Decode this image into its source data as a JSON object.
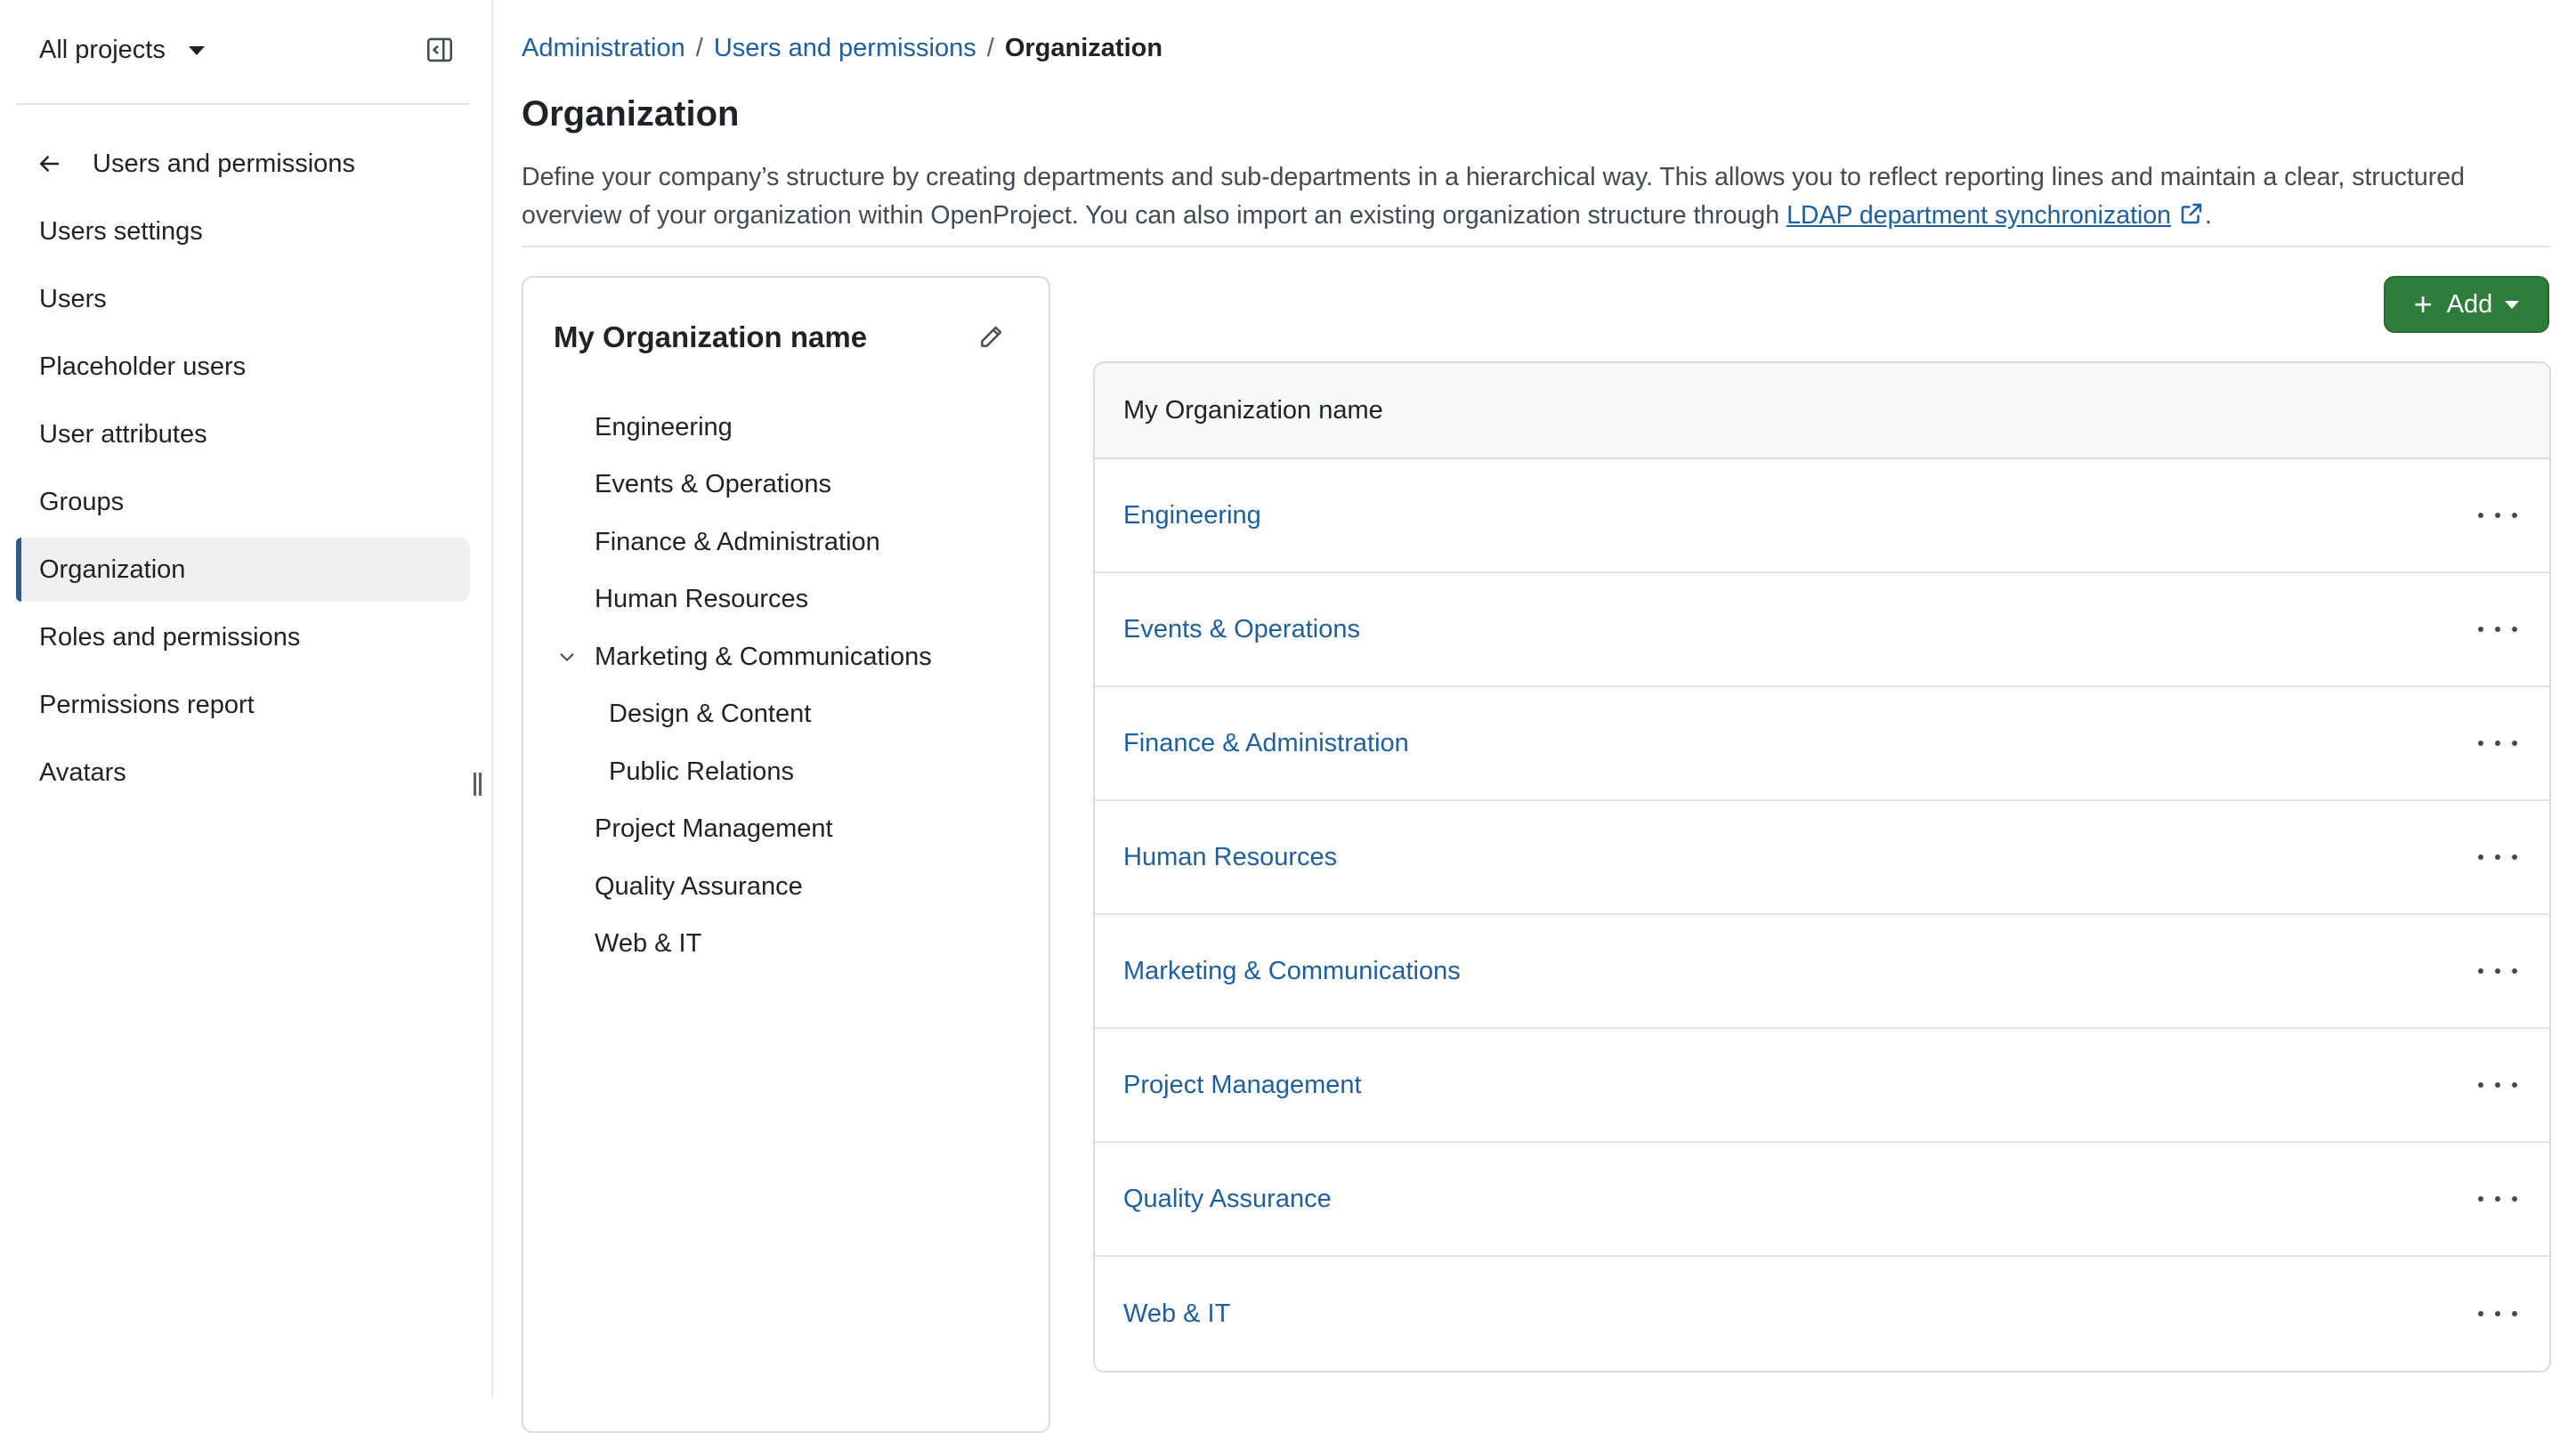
{
  "sidebar": {
    "project_switcher": "All projects",
    "back_label": "Users and permissions",
    "items": [
      {
        "label": "Users settings",
        "active": false
      },
      {
        "label": "Users",
        "active": false
      },
      {
        "label": "Placeholder users",
        "active": false
      },
      {
        "label": "User attributes",
        "active": false
      },
      {
        "label": "Groups",
        "active": false
      },
      {
        "label": "Organization",
        "active": true
      },
      {
        "label": "Roles and permissions",
        "active": false
      },
      {
        "label": "Permissions report",
        "active": false
      },
      {
        "label": "Avatars",
        "active": false
      }
    ]
  },
  "breadcrumb": {
    "items": [
      "Administration",
      "Users and permissions"
    ],
    "separator": "/",
    "current": "Organization"
  },
  "page": {
    "title": "Organization",
    "description": "Define your company’s structure by creating departments and sub-departments in a hierarchical way. This allows you to reflect reporting lines and maintain a clear, structured overview of your organization within OpenProject. You can also import an existing organization structure through",
    "link_text": "LDAP department synchronization",
    "trailing": "."
  },
  "tree": {
    "title": "My Organization name",
    "items": [
      {
        "label": "Engineering",
        "level": 0
      },
      {
        "label": "Events & Operations",
        "level": 0
      },
      {
        "label": "Finance & Administration",
        "level": 0
      },
      {
        "label": "Human Resources",
        "level": 0
      },
      {
        "label": "Marketing & Communications",
        "level": 0,
        "expanded": true
      },
      {
        "label": "Design & Content",
        "level": 1
      },
      {
        "label": "Public Relations",
        "level": 1
      },
      {
        "label": "Project Management",
        "level": 0
      },
      {
        "label": "Quality Assurance",
        "level": 0
      },
      {
        "label": "Web & IT",
        "level": 0
      }
    ]
  },
  "add_button": {
    "label": "Add",
    "color": "#2e7d3a"
  },
  "list": {
    "header": "My Organization name",
    "rows": [
      "Engineering",
      "Events & Operations",
      "Finance & Administration",
      "Human Resources",
      "Marketing & Communications",
      "Project Management",
      "Quality Assurance",
      "Web & IT"
    ]
  },
  "colors": {
    "link": "#1f5f9e",
    "active_indicator": "#2f5a8c",
    "primary": "#2e7d3a"
  }
}
